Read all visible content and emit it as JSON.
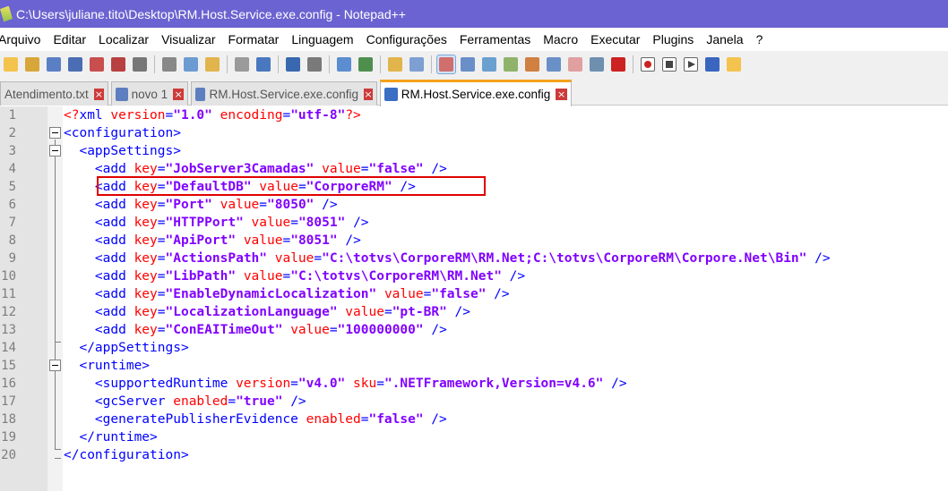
{
  "window": {
    "title": "C:\\Users\\juliane.tito\\Desktop\\RM.Host.Service.exe.config - Notepad++"
  },
  "menu": [
    "Arquivo",
    "Editar",
    "Localizar",
    "Visualizar",
    "Formatar",
    "Linguagem",
    "Configurações",
    "Ferramentas",
    "Macro",
    "Executar",
    "Plugins",
    "Janela",
    "?"
  ],
  "toolbar_icons": [
    "new-file-icon",
    "open-file-icon",
    "save-icon",
    "save-all-icon",
    "close-icon",
    "close-all-icon",
    "print-icon",
    "sep",
    "cut-icon",
    "copy-icon",
    "paste-icon",
    "sep",
    "undo-icon",
    "redo-icon",
    "sep",
    "find-icon",
    "replace-icon",
    "sep",
    "zoom-in-icon",
    "zoom-out-icon",
    "sep",
    "sync-vertical-icon",
    "sync-horizontal-icon",
    "sep",
    "word-wrap-icon",
    "show-all-chars-icon",
    "indent-guide-icon",
    "udl-icon",
    "doc-map-icon",
    "function-list-icon",
    "folder-workspace-icon",
    "doc-list-icon",
    "monitoring-icon",
    "sep",
    "record-macro-icon",
    "stop-macro-icon",
    "play-macro-icon",
    "play-multiple-macro-icon",
    "save-macro-icon"
  ],
  "tabs": [
    {
      "label": "Atendimento.txt",
      "active": false
    },
    {
      "label": "novo 1",
      "active": false
    },
    {
      "label": "RM.Host.Service.exe.config",
      "active": false
    },
    {
      "label": "RM.Host.Service.exe.config",
      "active": true
    }
  ],
  "colors": {
    "titlebar": "#6b63d1",
    "tag": "#0000ff",
    "attr": "#ff0000",
    "value": "#8000ff",
    "highlight": "#e00000",
    "active_tab_accent": "#f6a21c"
  },
  "lines": [
    {
      "n": "1",
      "indent": "",
      "parts": [
        [
          "pi",
          "<?"
        ],
        [
          "tag",
          "xml "
        ],
        [
          "attr",
          "version"
        ],
        [
          "tag",
          "="
        ],
        [
          "val",
          "\"1.0\""
        ],
        [
          "attr",
          " encoding"
        ],
        [
          "tag",
          "="
        ],
        [
          "val",
          "\"utf-8\""
        ],
        [
          "pi",
          "?>"
        ]
      ]
    },
    {
      "n": "2",
      "indent": "",
      "parts": [
        [
          "tag",
          "<configuration>"
        ]
      ]
    },
    {
      "n": "3",
      "indent": "  ",
      "parts": [
        [
          "tag",
          "<appSettings>"
        ]
      ]
    },
    {
      "n": "4",
      "indent": "    ",
      "parts": [
        [
          "tag",
          "<add "
        ],
        [
          "attr",
          "key"
        ],
        [
          "tag",
          "="
        ],
        [
          "val",
          "\"JobServer3Camadas\""
        ],
        [
          "attr",
          " value"
        ],
        [
          "tag",
          "="
        ],
        [
          "val",
          "\"false\""
        ],
        [
          "tag",
          " />"
        ]
      ]
    },
    {
      "n": "5",
      "indent": "    ",
      "parts": [
        [
          "tag",
          "<add "
        ],
        [
          "attr",
          "key"
        ],
        [
          "tag",
          "="
        ],
        [
          "val",
          "\"DefaultDB\""
        ],
        [
          "attr",
          " value"
        ],
        [
          "tag",
          "="
        ],
        [
          "val",
          "\"CorporeRM\""
        ],
        [
          "tag",
          " />"
        ]
      ]
    },
    {
      "n": "6",
      "indent": "    ",
      "parts": [
        [
          "tag",
          "<add "
        ],
        [
          "attr",
          "key"
        ],
        [
          "tag",
          "="
        ],
        [
          "val",
          "\"Port\""
        ],
        [
          "attr",
          " value"
        ],
        [
          "tag",
          "="
        ],
        [
          "val",
          "\"8050\""
        ],
        [
          "tag",
          " />"
        ]
      ]
    },
    {
      "n": "7",
      "indent": "    ",
      "parts": [
        [
          "tag",
          "<add "
        ],
        [
          "attr",
          "key"
        ],
        [
          "tag",
          "="
        ],
        [
          "val",
          "\"HTTPPort\""
        ],
        [
          "attr",
          " value"
        ],
        [
          "tag",
          "="
        ],
        [
          "val",
          "\"8051\""
        ],
        [
          "tag",
          " />"
        ]
      ]
    },
    {
      "n": "8",
      "indent": "    ",
      "parts": [
        [
          "tag",
          "<add "
        ],
        [
          "attr",
          "key"
        ],
        [
          "tag",
          "="
        ],
        [
          "val",
          "\"ApiPort\""
        ],
        [
          "attr",
          " value"
        ],
        [
          "tag",
          "="
        ],
        [
          "val",
          "\"8051\""
        ],
        [
          "tag",
          " />"
        ]
      ]
    },
    {
      "n": "9",
      "indent": "    ",
      "parts": [
        [
          "tag",
          "<add "
        ],
        [
          "attr",
          "key"
        ],
        [
          "tag",
          "="
        ],
        [
          "val",
          "\"ActionsPath\""
        ],
        [
          "attr",
          " value"
        ],
        [
          "tag",
          "="
        ],
        [
          "val",
          "\"C:\\totvs\\CorporeRM\\RM.Net;C:\\totvs\\CorporeRM\\Corpore.Net\\Bin\""
        ],
        [
          "tag",
          " />"
        ]
      ]
    },
    {
      "n": "10",
      "indent": "    ",
      "parts": [
        [
          "tag",
          "<add "
        ],
        [
          "attr",
          "key"
        ],
        [
          "tag",
          "="
        ],
        [
          "val",
          "\"LibPath\""
        ],
        [
          "attr",
          " value"
        ],
        [
          "tag",
          "="
        ],
        [
          "val",
          "\"C:\\totvs\\CorporeRM\\RM.Net\""
        ],
        [
          "tag",
          " />"
        ]
      ]
    },
    {
      "n": "11",
      "indent": "    ",
      "parts": [
        [
          "tag",
          "<add "
        ],
        [
          "attr",
          "key"
        ],
        [
          "tag",
          "="
        ],
        [
          "val",
          "\"EnableDynamicLocalization\""
        ],
        [
          "attr",
          " value"
        ],
        [
          "tag",
          "="
        ],
        [
          "val",
          "\"false\""
        ],
        [
          "tag",
          " />"
        ]
      ]
    },
    {
      "n": "12",
      "indent": "    ",
      "parts": [
        [
          "tag",
          "<add "
        ],
        [
          "attr",
          "key"
        ],
        [
          "tag",
          "="
        ],
        [
          "val",
          "\"LocalizationLanguage\""
        ],
        [
          "attr",
          " value"
        ],
        [
          "tag",
          "="
        ],
        [
          "val",
          "\"pt-BR\""
        ],
        [
          "tag",
          " />"
        ]
      ]
    },
    {
      "n": "13",
      "indent": "    ",
      "parts": [
        [
          "tag",
          "<add "
        ],
        [
          "attr",
          "key"
        ],
        [
          "tag",
          "="
        ],
        [
          "val",
          "\"ConEAITimeOut\""
        ],
        [
          "attr",
          " value"
        ],
        [
          "tag",
          "="
        ],
        [
          "val",
          "\"100000000\""
        ],
        [
          "tag",
          " />"
        ]
      ]
    },
    {
      "n": "14",
      "indent": "  ",
      "parts": [
        [
          "tag",
          "</appSettings>"
        ]
      ]
    },
    {
      "n": "15",
      "indent": "  ",
      "parts": [
        [
          "tag",
          "<runtime>"
        ]
      ]
    },
    {
      "n": "16",
      "indent": "    ",
      "parts": [
        [
          "tag",
          "<supportedRuntime "
        ],
        [
          "attr",
          "version"
        ],
        [
          "tag",
          "="
        ],
        [
          "val",
          "\"v4.0\""
        ],
        [
          "attr",
          " sku"
        ],
        [
          "tag",
          "="
        ],
        [
          "val",
          "\".NETFramework,Version=v4.6\""
        ],
        [
          "tag",
          " />"
        ]
      ]
    },
    {
      "n": "17",
      "indent": "    ",
      "parts": [
        [
          "tag",
          "<gcServer "
        ],
        [
          "attr",
          "enabled"
        ],
        [
          "tag",
          "="
        ],
        [
          "val",
          "\"true\""
        ],
        [
          "tag",
          " />"
        ]
      ]
    },
    {
      "n": "18",
      "indent": "    ",
      "parts": [
        [
          "tag",
          "<generatePublisherEvidence "
        ],
        [
          "attr",
          "enabled"
        ],
        [
          "tag",
          "="
        ],
        [
          "val",
          "\"false\""
        ],
        [
          "tag",
          " />"
        ]
      ]
    },
    {
      "n": "19",
      "indent": "  ",
      "parts": [
        [
          "tag",
          "</runtime>"
        ]
      ]
    },
    {
      "n": "20",
      "indent": "",
      "parts": [
        [
          "tag",
          "</configuration>"
        ]
      ]
    }
  ]
}
